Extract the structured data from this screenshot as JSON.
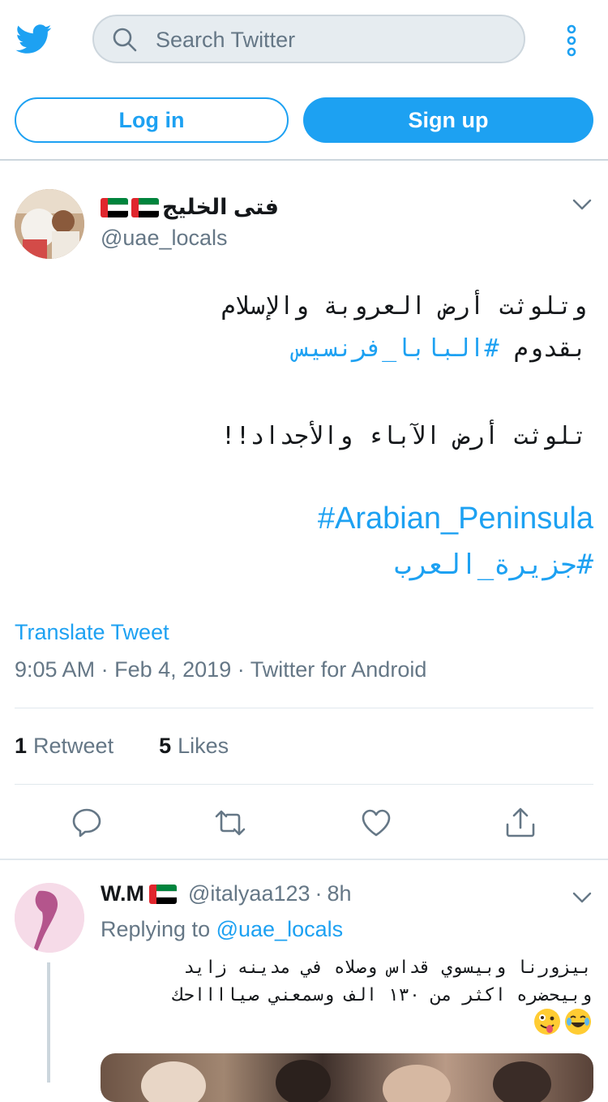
{
  "header": {
    "search_placeholder": "Search Twitter",
    "login_label": "Log in",
    "signup_label": "Sign up",
    "icons": [
      "twitter-bird-icon",
      "search-icon",
      "more-vertical-icon"
    ]
  },
  "tweet": {
    "display_name": "فتى الخليج",
    "handle": "@uae_locals",
    "line1": "وتلوثت أرض العروبة والإسلام",
    "line2_prefix": "بقدوم ",
    "line2_hashtag": "#البابا_فرنسيس",
    "line3": "تلوثت أرض الآباء والأجداد!!",
    "hashtag_en": "#Arabian_Peninsula",
    "hashtag_ar": "#جزيرة_العرب",
    "translate": "Translate Tweet",
    "time": "9:05 AM",
    "date": "Feb 4, 2019",
    "source": "Twitter for Android",
    "separator": "·",
    "retweets_count": "1",
    "retweets_label": "Retweet",
    "likes_count": "5",
    "likes_label": "Likes"
  },
  "reply": {
    "display_name": "W.M",
    "handle": "@italyaa123",
    "separator": "·",
    "age": "8h",
    "replying_prefix": "Replying to ",
    "replying_handle": "@uae_locals",
    "line1": "بيزورنا وبيسوي قداس وصلاه في مدينه زايد",
    "line2": "وبيحضره اكثر من ١٣٠ الف وسمعني صيااااحك"
  },
  "colors": {
    "accent": "#1da1f2",
    "secondary_text": "#657786",
    "divider": "#e1e8ed"
  }
}
